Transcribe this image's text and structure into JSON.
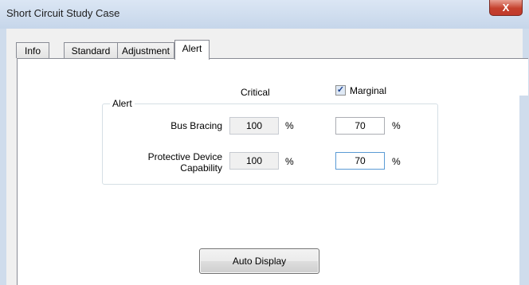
{
  "window": {
    "title": "Short Circuit Study Case",
    "close_glyph": "X"
  },
  "tabs": [
    {
      "label": "Info",
      "active": false
    },
    {
      "label": "Standard",
      "active": false
    },
    {
      "label": "Adjustment",
      "active": false
    },
    {
      "label": "Alert",
      "active": true
    }
  ],
  "alert": {
    "critical_header": "Critical",
    "marginal_header": "Marginal",
    "marginal_checked": true,
    "group_title": "Alert",
    "rows": [
      {
        "label_line1": "Bus Bracing",
        "label_line2": "",
        "critical": "100",
        "critical_unit": "%",
        "marginal": "70",
        "marginal_unit": "%"
      },
      {
        "label_line1": "Protective Device",
        "label_line2": "Capability",
        "critical": "100",
        "critical_unit": "%",
        "marginal": "70",
        "marginal_unit": "%"
      }
    ]
  },
  "buttons": {
    "auto_display": "Auto Display"
  },
  "colors": {
    "title_bar": "#c6d6ea",
    "close_button": "#c5412d",
    "focus_border": "#5b9bd5"
  }
}
